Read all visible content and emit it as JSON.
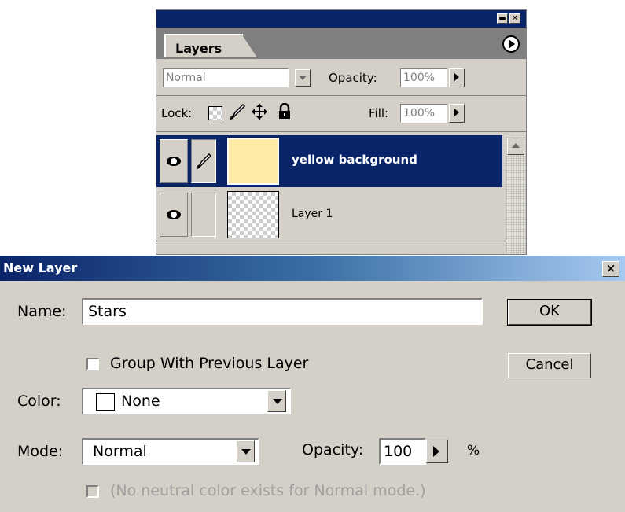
{
  "layers_panel": {
    "tab_label": "Layers",
    "blend_mode": "Normal",
    "opacity_label": "Opacity:",
    "opacity_value": "100%",
    "lock_label": "Lock:",
    "fill_label": "Fill:",
    "fill_value": "100%",
    "layers": [
      {
        "name": "yellow background",
        "selected": true,
        "thumb_color": "#ffeaa6"
      },
      {
        "name": "Layer 1",
        "selected": false
      }
    ]
  },
  "dialog": {
    "title": "New Layer",
    "close_label": "×",
    "name_label": "Name:",
    "name_value": "Stars",
    "ok_label": "OK",
    "cancel_label": "Cancel",
    "group_label": "Group With Previous Layer",
    "color_label": "Color:",
    "color_value": "None",
    "mode_label": "Mode:",
    "mode_value": "Normal",
    "opacity_label": "Opacity:",
    "opacity_value": "100",
    "percent_label": "%",
    "neutral_label": "(No neutral color exists for Normal mode.)"
  },
  "colors": {
    "selection": "#0a246a",
    "face": "#d4d0c8"
  }
}
